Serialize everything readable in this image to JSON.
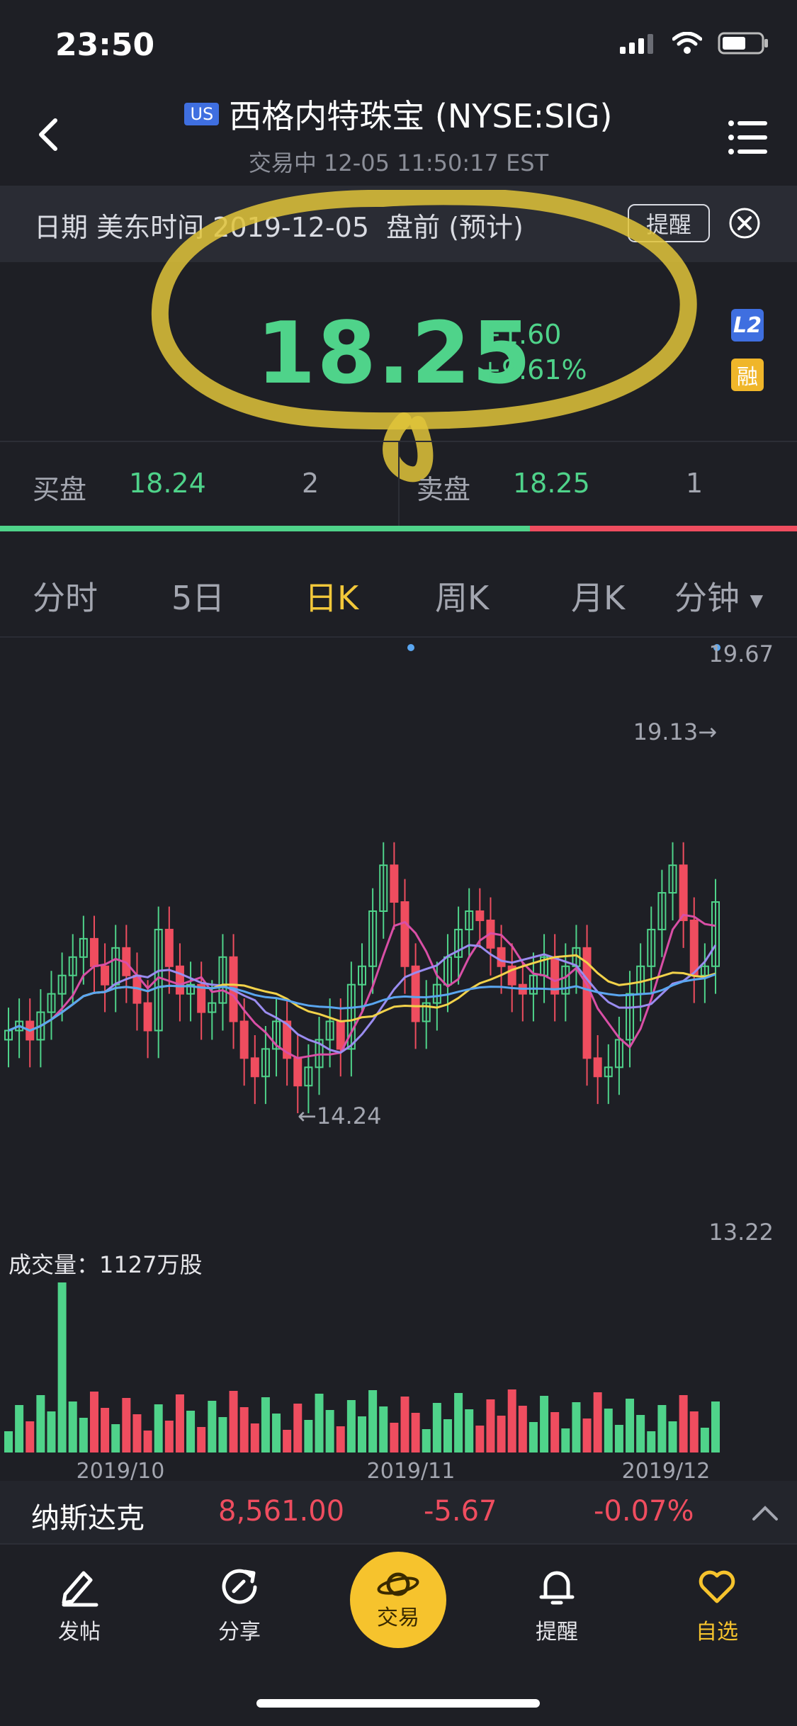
{
  "status": {
    "time": "23:50"
  },
  "header": {
    "badge": "US",
    "title": "西格内特珠宝 (NYSE:SIG)",
    "subtitle": "交易中 12-05 11:50:17 EST"
  },
  "notice": {
    "text": "日期 美东时间 2019-12-05  盘前 (预计)",
    "alert_label": "提醒"
  },
  "quote": {
    "price": "18.25",
    "change": "+1.60",
    "change_pct": "+9.61%",
    "badge_l2": "L2",
    "badge_margin": "融"
  },
  "order_book": {
    "bid_label": "买盘",
    "bid_price": "18.24",
    "bid_size": "2",
    "ask_label": "卖盘",
    "ask_price": "18.25",
    "ask_size": "1",
    "bid_ratio": 0.665
  },
  "tabs": [
    "分时",
    "5日",
    "日K",
    "周K",
    "月K",
    "分钟"
  ],
  "active_tab": "日K",
  "chart": {
    "y_max_label": "19.67",
    "y_min_label": "13.22",
    "high_label": "19.13→",
    "low_label": "←14.24",
    "volume_label": "成交量：1127万股",
    "x_labels": [
      "2019/10",
      "2019/11",
      "2019/12"
    ]
  },
  "chart_data": {
    "type": "candlestick",
    "y_range": [
      13.22,
      19.67
    ],
    "high": 19.13,
    "low": 14.24,
    "colors": {
      "up": "#4fd38a",
      "down": "#ef4d5f",
      "ma5": "#d94fa6",
      "ma10": "#f2d24a",
      "ma20": "#5aa6f0",
      "ma60": "#9a8cf0"
    }
  },
  "market_ticker": {
    "name": "纳斯达克",
    "value": "8,561.00",
    "change": "-5.67",
    "change_pct": "-0.07%"
  },
  "tabbar": {
    "post": "发帖",
    "share": "分享",
    "trade": "交易",
    "alert": "提醒",
    "watchlist": "自选"
  },
  "colors": {
    "accent": "#f6c32d",
    "up": "#4fd38a",
    "down": "#ef4d5f",
    "background": "#1e1f25"
  }
}
